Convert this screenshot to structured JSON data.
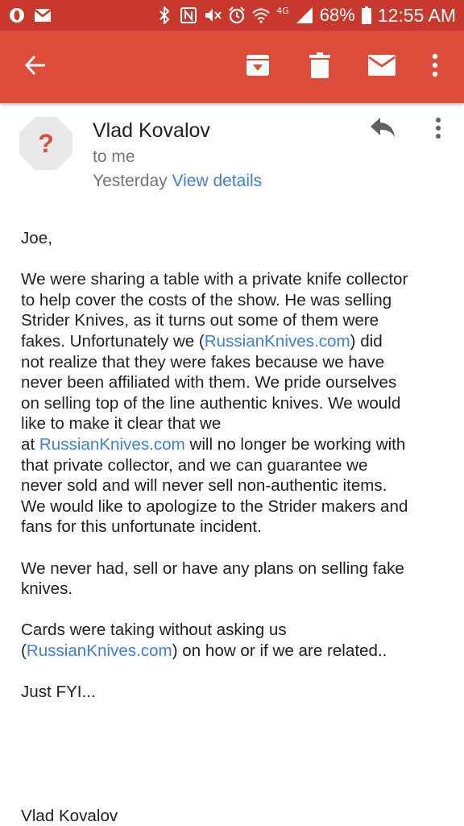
{
  "status_bar": {
    "network": "4G",
    "battery": "68%",
    "time": "12:55 AM"
  },
  "icons": {
    "back": "arrow-back-icon",
    "archive": "archive-icon",
    "delete": "trash-icon",
    "unread": "mail-icon",
    "more": "more-vert-icon",
    "reply": "reply-icon"
  },
  "colors": {
    "app_bar": "#dd4b39",
    "status_bar": "#c8382c",
    "link": "#3b7fe0"
  },
  "email": {
    "avatar_glyph": "?",
    "sender": "Vlad Kovalov",
    "recipient": "to me",
    "date": "Yesterday",
    "view_details": "View details",
    "greeting": "Joe,",
    "p1": {
      "a": "We were sharing a table with a private knife collector",
      "b": "to help cover the costs of the show. He was selling",
      "c": "Strider Knives, as it turns out some of them were",
      "d1": "fakes. Unfortunately we (",
      "d_link": "RussianKnives.com",
      "d2": ") did",
      "e": "not realize that they were fakes because we have",
      "f": "never been affiliated with them. We pride ourselves",
      "g": "on selling top of the line authentic knives. We would",
      "h": "like to make it clear that we",
      "i1": "at ",
      "i_link": "RussianKnives.com",
      "i2": " will no longer be working with",
      "j": "that private collector, and we can guarantee we",
      "k": "never sold and will never sell non-authentic items.",
      "l": "We would like to apologize to the Strider makers and",
      "m": "fans for this unfortunate incident."
    },
    "p2": {
      "a": "We never had, sell or have any plans on selling fake",
      "b": "knives."
    },
    "p3": {
      "a": "Cards were taking without asking us",
      "b1": "(",
      "b_link": "RussianKnives.com",
      "b2": ") on how or if we are related.."
    },
    "p4": "Just FYI...",
    "signature": "Vlad Kovalov"
  }
}
